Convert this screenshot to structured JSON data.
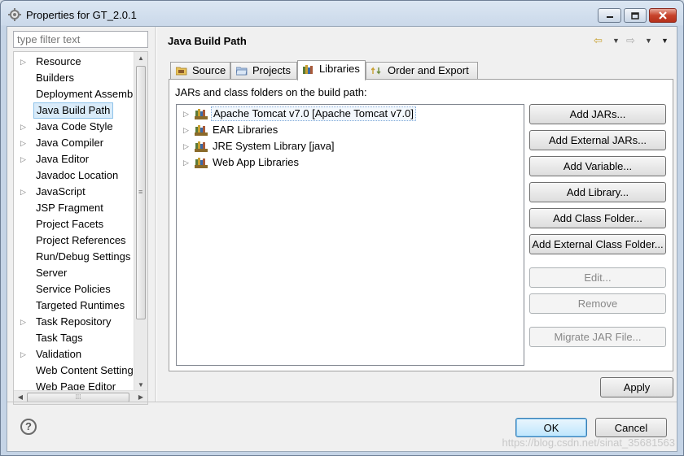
{
  "window": {
    "title": "Properties for GT_2.0.1",
    "icons": {
      "app": "gear-icon",
      "minimize": "minimize-icon",
      "maximize": "maximize-icon",
      "close": "close-icon"
    }
  },
  "sidebar": {
    "filter_placeholder": "type filter text",
    "items": [
      {
        "label": "Resource",
        "expandable": true
      },
      {
        "label": "Builders",
        "expandable": false
      },
      {
        "label": "Deployment Assembly",
        "expandable": false
      },
      {
        "label": "Java Build Path",
        "expandable": false,
        "selected": true
      },
      {
        "label": "Java Code Style",
        "expandable": true
      },
      {
        "label": "Java Compiler",
        "expandable": true
      },
      {
        "label": "Java Editor",
        "expandable": true
      },
      {
        "label": "Javadoc Location",
        "expandable": false
      },
      {
        "label": "JavaScript",
        "expandable": true
      },
      {
        "label": "JSP Fragment",
        "expandable": false
      },
      {
        "label": "Project Facets",
        "expandable": false
      },
      {
        "label": "Project References",
        "expandable": false
      },
      {
        "label": "Run/Debug Settings",
        "expandable": false
      },
      {
        "label": "Server",
        "expandable": false
      },
      {
        "label": "Service Policies",
        "expandable": false
      },
      {
        "label": "Targeted Runtimes",
        "expandable": false
      },
      {
        "label": "Task Repository",
        "expandable": true
      },
      {
        "label": "Task Tags",
        "expandable": false
      },
      {
        "label": "Validation",
        "expandable": true
      },
      {
        "label": "Web Content Settings",
        "expandable": false
      },
      {
        "label": "Web Page Editor",
        "expandable": false
      }
    ]
  },
  "page": {
    "title": "Java Build Path",
    "tabs": [
      {
        "label": "Source",
        "icon": "source-folder-icon"
      },
      {
        "label": "Projects",
        "icon": "project-folder-icon"
      },
      {
        "label": "Libraries",
        "icon": "library-icon",
        "active": true
      },
      {
        "label": "Order and Export",
        "icon": "order-export-icon"
      }
    ],
    "libraries": {
      "caption": "JARs and class folders on the build path:",
      "entries": [
        {
          "label": "Apache Tomcat v7.0 [Apache Tomcat v7.0]",
          "icon": "library-icon",
          "focused": true
        },
        {
          "label": "EAR Libraries",
          "icon": "library-icon"
        },
        {
          "label": "JRE System Library [java]",
          "icon": "library-icon"
        },
        {
          "label": "Web App Libraries",
          "icon": "library-icon"
        }
      ]
    },
    "buttons": [
      {
        "label": "Add JARs...",
        "enabled": true
      },
      {
        "label": "Add External JARs...",
        "enabled": true
      },
      {
        "label": "Add Variable...",
        "enabled": true
      },
      {
        "label": "Add Library...",
        "enabled": true
      },
      {
        "label": "Add Class Folder...",
        "enabled": true
      },
      {
        "label": "Add External Class Folder...",
        "enabled": true
      },
      {
        "label": "Edit...",
        "enabled": false
      },
      {
        "label": "Remove",
        "enabled": false
      },
      {
        "label": "Migrate JAR File...",
        "enabled": false
      }
    ],
    "apply_label": "Apply"
  },
  "footer": {
    "help_glyph": "?",
    "ok_label": "OK",
    "cancel_label": "Cancel",
    "watermark": "https://blog.csdn.net/sinat_35681563"
  }
}
